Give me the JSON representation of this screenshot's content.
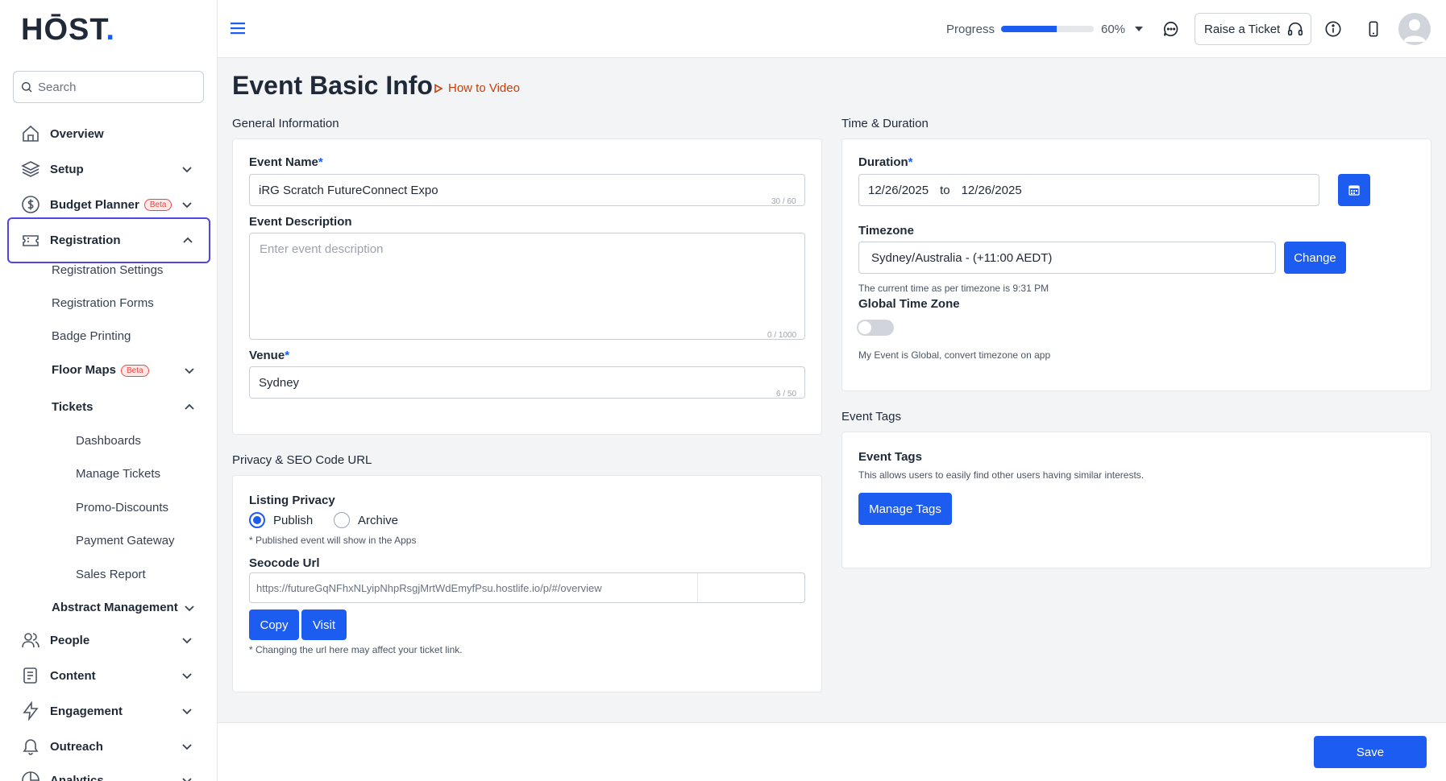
{
  "brand": {
    "logo": "HŌST",
    "dot": ".",
    "accent": "#1d5cf0"
  },
  "search": {
    "placeholder": "Search"
  },
  "sidebar": {
    "items": [
      {
        "label": "Overview",
        "icon": "home-icon"
      },
      {
        "label": "Setup",
        "icon": "layers-icon"
      },
      {
        "label": "Budget Planner",
        "badge": "Beta",
        "icon": "dollar-icon"
      },
      {
        "label": "Registration",
        "icon": "ticket-icon",
        "active": true
      },
      {
        "label": "People",
        "icon": "users-icon"
      },
      {
        "label": "Content",
        "icon": "content-icon"
      },
      {
        "label": "Engagement",
        "icon": "bolt-icon"
      },
      {
        "label": "Outreach",
        "icon": "bell-icon"
      },
      {
        "label": "Analytics",
        "icon": "chart-icon"
      }
    ],
    "registration_sub": {
      "settings": "Registration Settings",
      "forms": "Registration Forms",
      "badge": "Badge Printing",
      "floor_maps": "Floor Maps",
      "floor_maps_badge": "Beta",
      "tickets": "Tickets",
      "tickets_sub": [
        "Dashboards",
        "Manage Tickets",
        "Promo-Discounts",
        "Payment Gateway",
        "Sales Report"
      ],
      "abstract": "Abstract Management"
    }
  },
  "topbar": {
    "progress_label": "Progress",
    "progress_value": "60%",
    "progress_fraction": 0.6,
    "raise_ticket": "Raise a Ticket"
  },
  "page": {
    "title": "Event Basic Info",
    "how_to": "How to Video"
  },
  "general": {
    "heading": "General Information",
    "event_name_label": "Event Name",
    "event_name_value": "iRG Scratch FutureConnect Expo",
    "event_name_counter": "30 / 60",
    "desc_label": "Event Description",
    "desc_placeholder": "Enter event description",
    "desc_counter": "0 / 1000",
    "venue_label": "Venue",
    "venue_value": "Sydney",
    "venue_counter": "6 / 50",
    "required_mark": "*"
  },
  "privacy": {
    "heading": "Privacy & SEO Code URL",
    "listing_label": "Listing Privacy",
    "publish": "Publish",
    "archive": "Archive",
    "publish_note": "* Published event will show in the Apps",
    "seo_label": "Seocode Url",
    "seo_url": "https://futureGqNFhxNLyipNhpRsgjMrtWdEmyfPsu.hostlife.io/p/#/overview",
    "copy": "Copy",
    "visit": "Visit",
    "url_note": "* Changing the url here may affect your ticket link."
  },
  "time": {
    "heading": "Time & Duration",
    "duration_label": "Duration",
    "start": "12/26/2025",
    "to": "to",
    "end": "12/26/2025",
    "timezone_label": "Timezone",
    "timezone_value": "Sydney/Australia - (+11:00 AEDT)",
    "change": "Change",
    "current_time": "The current time as per timezone is 9:31 PM",
    "global_label": "Global Time Zone",
    "global_note": "My Event is Global, convert timezone on app"
  },
  "tags": {
    "heading": "Event Tags",
    "card_title": "Event Tags",
    "description": "This allows users to easily find other users having similar interests.",
    "manage": "Manage Tags"
  },
  "footer": {
    "save": "Save"
  }
}
